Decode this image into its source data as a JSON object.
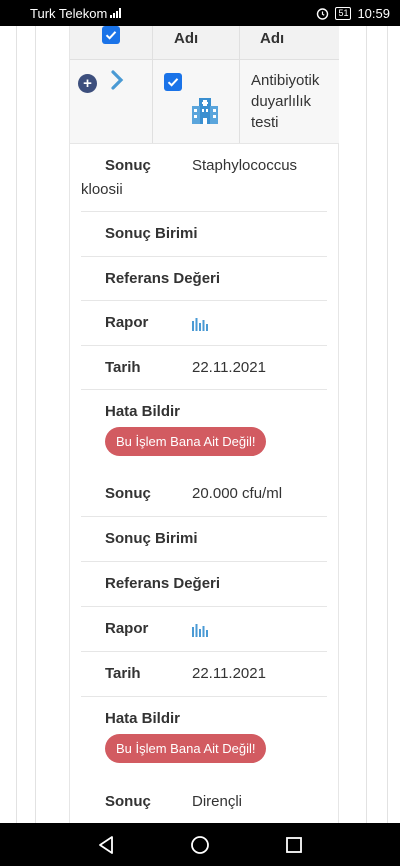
{
  "status_bar": {
    "carrier": "Turk Telekom",
    "battery": "51",
    "time": "10:59"
  },
  "table": {
    "headers": [
      "",
      "Adı",
      "Adı"
    ],
    "row": {
      "test_name": "Antibiyotik duyarlılık testi"
    }
  },
  "results": [
    {
      "sonuc_label": "Sonuç",
      "sonuc_value": "Staphylococcus kloosii",
      "birim_label": "Sonuç Birimi",
      "referans_label": "Referans Değeri",
      "rapor_label": "Rapor",
      "tarih_label": "Tarih",
      "tarih_value": "22.11.2021",
      "hata_label": "Hata Bildir",
      "hata_button": "Bu İşlem Bana Ait Değil!"
    },
    {
      "sonuc_label": "Sonuç",
      "sonuc_value": "20.000 cfu/ml",
      "birim_label": "Sonuç Birimi",
      "referans_label": "Referans Değeri",
      "rapor_label": "Rapor",
      "tarih_label": "Tarih",
      "tarih_value": "22.11.2021",
      "hata_label": "Hata Bildir",
      "hata_button": "Bu İşlem Bana Ait Değil!"
    },
    {
      "sonuc_label": "Sonuç",
      "sonuc_value": "Dirençli"
    }
  ],
  "colors": {
    "accent": "#1a73e8",
    "danger": "#d25b61",
    "chart_icon": "#4a9ad4"
  },
  "icons": [
    "checkbox-icon",
    "expand-plus-icon",
    "chevron-right-icon",
    "hospital-icon",
    "report-chart-icon",
    "back-icon",
    "home-icon",
    "recents-icon"
  ]
}
